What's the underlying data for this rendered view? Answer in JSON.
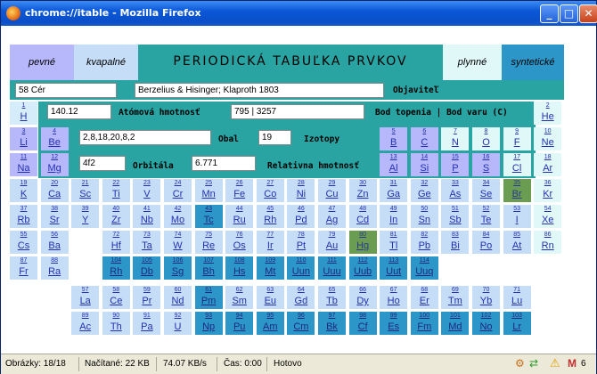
{
  "window": {
    "title": "chrome://itable - Mozilla Firefox",
    "minimize": "_",
    "maximize": "□",
    "close": "✕"
  },
  "legend": {
    "solid": "pevné",
    "liquid": "kvapalné",
    "heading": "PERIODICKÁ TABUĽKA PRVKOV",
    "gas": "plynné",
    "synthetic": "syntetické"
  },
  "info": {
    "element_field": "58 Cér",
    "discoverer_field": "Berzelius & Hisinger; Klaproth 1803",
    "discoverer_label": "Objaviteľ",
    "mass_field": "140.12",
    "mass_label": "Atómová hmotnosť",
    "melt_field": "795 | 3257",
    "melt_label": "Bod topenia | Bod varu (C)",
    "shell_field": "2,8,18,20,8,2",
    "shell_label": "Obal",
    "isotopes_field": "19",
    "isotopes_label": "Izotopy",
    "orbital_field": "4f2",
    "orbital_label": "Orbitála",
    "density_field": "6.771",
    "density_label": "Relativna hmotnosť"
  },
  "elements": [
    {
      "n": "1",
      "s": "H",
      "c": "gas"
    },
    {
      "n": "2",
      "s": "He",
      "c": "cyan"
    },
    {
      "n": "3",
      "s": "Li",
      "c": "nm"
    },
    {
      "n": "4",
      "s": "Be",
      "c": "nm"
    },
    {
      "n": "5",
      "s": "B",
      "c": "nm"
    },
    {
      "n": "6",
      "s": "C",
      "c": "nm"
    },
    {
      "n": "7",
      "s": "N",
      "c": "cyan"
    },
    {
      "n": "8",
      "s": "O",
      "c": "cyan"
    },
    {
      "n": "9",
      "s": "F",
      "c": "cyan"
    },
    {
      "n": "10",
      "s": "Ne",
      "c": "cyan"
    },
    {
      "n": "11",
      "s": "Na",
      "c": "nm"
    },
    {
      "n": "12",
      "s": "Mg",
      "c": "nm"
    },
    {
      "n": "13",
      "s": "Al",
      "c": "nm"
    },
    {
      "n": "14",
      "s": "Si",
      "c": "nm"
    },
    {
      "n": "15",
      "s": "P",
      "c": "nm"
    },
    {
      "n": "16",
      "s": "S",
      "c": "nm"
    },
    {
      "n": "17",
      "s": "Cl",
      "c": "cyan"
    },
    {
      "n": "18",
      "s": "Ar",
      "c": "cyan"
    },
    {
      "n": "19",
      "s": "K"
    },
    {
      "n": "20",
      "s": "Ca"
    },
    {
      "n": "21",
      "s": "Sc"
    },
    {
      "n": "22",
      "s": "Ti"
    },
    {
      "n": "23",
      "s": "V"
    },
    {
      "n": "24",
      "s": "Cr"
    },
    {
      "n": "25",
      "s": "Mn"
    },
    {
      "n": "26",
      "s": "Fe"
    },
    {
      "n": "27",
      "s": "Co"
    },
    {
      "n": "28",
      "s": "Ni"
    },
    {
      "n": "29",
      "s": "Cu"
    },
    {
      "n": "30",
      "s": "Zn"
    },
    {
      "n": "31",
      "s": "Ga"
    },
    {
      "n": "32",
      "s": "Ge"
    },
    {
      "n": "33",
      "s": "As"
    },
    {
      "n": "34",
      "s": "Se"
    },
    {
      "n": "35",
      "s": "Br",
      "c": "green"
    },
    {
      "n": "36",
      "s": "Kr",
      "c": "cyan"
    },
    {
      "n": "37",
      "s": "Rb"
    },
    {
      "n": "38",
      "s": "Sr"
    },
    {
      "n": "39",
      "s": "Y"
    },
    {
      "n": "40",
      "s": "Zr"
    },
    {
      "n": "41",
      "s": "Nb"
    },
    {
      "n": "42",
      "s": "Mo"
    },
    {
      "n": "43",
      "s": "Tc",
      "c": "dark"
    },
    {
      "n": "44",
      "s": "Ru"
    },
    {
      "n": "45",
      "s": "Rh"
    },
    {
      "n": "46",
      "s": "Pd"
    },
    {
      "n": "47",
      "s": "Ag"
    },
    {
      "n": "48",
      "s": "Cd"
    },
    {
      "n": "49",
      "s": "In"
    },
    {
      "n": "50",
      "s": "Sn"
    },
    {
      "n": "51",
      "s": "Sb"
    },
    {
      "n": "52",
      "s": "Te"
    },
    {
      "n": "53",
      "s": "I"
    },
    {
      "n": "54",
      "s": "Xe",
      "c": "cyan"
    },
    {
      "n": "55",
      "s": "Cs"
    },
    {
      "n": "56",
      "s": "Ba"
    },
    {
      "n": "72",
      "s": "Hf"
    },
    {
      "n": "73",
      "s": "Ta"
    },
    {
      "n": "74",
      "s": "W"
    },
    {
      "n": "75",
      "s": "Re"
    },
    {
      "n": "76",
      "s": "Os"
    },
    {
      "n": "77",
      "s": "Ir"
    },
    {
      "n": "78",
      "s": "Pt"
    },
    {
      "n": "79",
      "s": "Au"
    },
    {
      "n": "80",
      "s": "Hg",
      "c": "green"
    },
    {
      "n": "81",
      "s": "Tl"
    },
    {
      "n": "82",
      "s": "Pb"
    },
    {
      "n": "83",
      "s": "Bi"
    },
    {
      "n": "84",
      "s": "Po"
    },
    {
      "n": "85",
      "s": "At"
    },
    {
      "n": "86",
      "s": "Rn",
      "c": "cyan"
    },
    {
      "n": "87",
      "s": "Fr"
    },
    {
      "n": "88",
      "s": "Ra"
    },
    {
      "n": "104",
      "s": "Rh",
      "c": "dark"
    },
    {
      "n": "105",
      "s": "Db",
      "c": "dark"
    },
    {
      "n": "106",
      "s": "Sg",
      "c": "dark"
    },
    {
      "n": "107",
      "s": "Bh",
      "c": "dark"
    },
    {
      "n": "108",
      "s": "Hs",
      "c": "dark"
    },
    {
      "n": "109",
      "s": "Mt",
      "c": "dark"
    },
    {
      "n": "110",
      "s": "Uun",
      "c": "dark"
    },
    {
      "n": "111",
      "s": "Uuu",
      "c": "dark"
    },
    {
      "n": "112",
      "s": "Uub",
      "c": "dark"
    },
    {
      "n": "113",
      "s": "Uut",
      "c": "dark"
    },
    {
      "n": "114",
      "s": "Uuq",
      "c": "dark"
    },
    {
      "n": "57",
      "s": "La"
    },
    {
      "n": "58",
      "s": "Ce"
    },
    {
      "n": "59",
      "s": "Pr"
    },
    {
      "n": "60",
      "s": "Nd"
    },
    {
      "n": "61",
      "s": "Pm",
      "c": "dark"
    },
    {
      "n": "62",
      "s": "Sm"
    },
    {
      "n": "63",
      "s": "Eu"
    },
    {
      "n": "64",
      "s": "Gd"
    },
    {
      "n": "65",
      "s": "Tb"
    },
    {
      "n": "66",
      "s": "Dy"
    },
    {
      "n": "67",
      "s": "Ho"
    },
    {
      "n": "68",
      "s": "Er"
    },
    {
      "n": "69",
      "s": "Tm"
    },
    {
      "n": "70",
      "s": "Yb"
    },
    {
      "n": "71",
      "s": "Lu"
    },
    {
      "n": "89",
      "s": "Ac"
    },
    {
      "n": "90",
      "s": "Th"
    },
    {
      "n": "91",
      "s": "Pa"
    },
    {
      "n": "92",
      "s": "U"
    },
    {
      "n": "93",
      "s": "Np",
      "c": "dark"
    },
    {
      "n": "94",
      "s": "Pu",
      "c": "dark"
    },
    {
      "n": "95",
      "s": "Am",
      "c": "dark"
    },
    {
      "n": "96",
      "s": "Cm",
      "c": "dark"
    },
    {
      "n": "97",
      "s": "Bk",
      "c": "dark"
    },
    {
      "n": "98",
      "s": "Cf",
      "c": "dark"
    },
    {
      "n": "99",
      "s": "Es",
      "c": "dark"
    },
    {
      "n": "100",
      "s": "Fm",
      "c": "dark"
    },
    {
      "n": "101",
      "s": "Md",
      "c": "dark"
    },
    {
      "n": "102",
      "s": "No",
      "c": "dark"
    },
    {
      "n": "103",
      "s": "Lr",
      "c": "dark"
    }
  ],
  "status": {
    "images": "Obrázky: 18/18",
    "loaded": "Načítané: 22 KB",
    "speed": "74.07 KB/s",
    "time": "Čas: 0:00",
    "done": "Hotovo",
    "mail_count": "6"
  }
}
